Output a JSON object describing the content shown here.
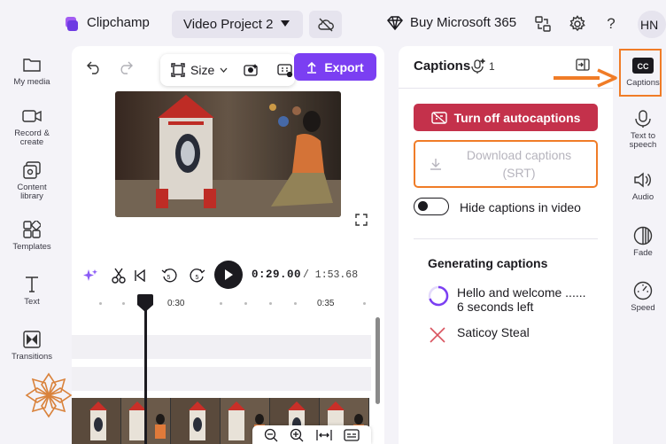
{
  "app": {
    "title": "Clipchamp"
  },
  "header": {
    "project_name": "Video Project 2",
    "buy_label": "Buy Microsoft 365",
    "avatar_initials": "HN"
  },
  "left_nav": [
    {
      "label": "My media",
      "icon": "folder-icon"
    },
    {
      "label": "Record & create",
      "icon": "camera-icon"
    },
    {
      "label": "Content library",
      "icon": "library-icon"
    },
    {
      "label": "Templates",
      "icon": "templates-icon"
    },
    {
      "label": "Text",
      "icon": "text-icon"
    },
    {
      "label": "Transitions",
      "icon": "transitions-icon"
    }
  ],
  "preview": {
    "size_label": "Size",
    "export_label": "Export"
  },
  "timeline": {
    "current_time": "0:29.00",
    "total_time": "/ 1:53.68",
    "ruler_labels": [
      "0:30",
      "0:35"
    ]
  },
  "captions_panel": {
    "title": "Captions",
    "badge_count": "1",
    "turn_off_label": "Turn off autocaptions",
    "download_label_line1": "Download captions",
    "download_label_line2": "(SRT)",
    "hide_label": "Hide captions in video",
    "hide_enabled": false,
    "generating_title": "Generating captions",
    "items": [
      {
        "line1": "Hello and welcome ......",
        "line2": "6 seconds left",
        "status": "in-progress"
      },
      {
        "line1": "Saticoy Steal",
        "line2": "",
        "status": "failed"
      }
    ]
  },
  "right_nav": [
    {
      "label": "Captions",
      "icon": "captions-icon",
      "active": true
    },
    {
      "label": "Text to speech",
      "icon": "text-to-speech-icon"
    },
    {
      "label": "Audio",
      "icon": "audio-icon"
    },
    {
      "label": "Fade",
      "icon": "fade-icon"
    },
    {
      "label": "Speed",
      "icon": "speed-icon"
    }
  ],
  "colors": {
    "accent": "#7b3ff2",
    "danger": "#c4314b",
    "highlight": "#f07c27",
    "background": "#f4f3f8"
  }
}
